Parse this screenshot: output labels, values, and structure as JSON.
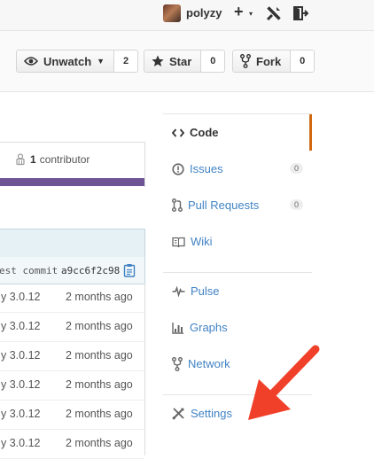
{
  "topbar": {
    "username": "polyzy",
    "plus": "+",
    "caret": "▾"
  },
  "repo_actions": {
    "watch": {
      "label": "Unwatch",
      "count": "2"
    },
    "star": {
      "label": "Star",
      "count": "0"
    },
    "fork": {
      "label": "Fork",
      "count": "0"
    }
  },
  "contributors": {
    "count": "1",
    "label": "contributor"
  },
  "file_table": {
    "commit_label": "est commit",
    "commit_sha": "a9cc6f2c98",
    "rows": [
      {
        "message": "y 3.0.12",
        "age": "2 months ago"
      },
      {
        "message": "y 3.0.12",
        "age": "2 months ago"
      },
      {
        "message": "y 3.0.12",
        "age": "2 months ago"
      },
      {
        "message": "y 3.0.12",
        "age": "2 months ago"
      },
      {
        "message": "y 3.0.12",
        "age": "2 months ago"
      },
      {
        "message": "y 3.0.12",
        "age": "2 months ago"
      }
    ]
  },
  "repo_nav": {
    "code": "Code",
    "issues": {
      "label": "Issues",
      "count": "0"
    },
    "pull_requests": {
      "label": "Pull Requests",
      "count": "0"
    },
    "wiki": "Wiki",
    "pulse": "Pulse",
    "graphs": "Graphs",
    "network": "Network",
    "settings": "Settings"
  },
  "colors": {
    "link": "#4183c4",
    "selected_accent": "#d26911",
    "contrib_bar": "#6e5494",
    "arrow": "#f0402a"
  },
  "icons": [
    "tools-icon",
    "sign-out-icon",
    "eye-icon",
    "star-icon",
    "fork-icon",
    "code-icon",
    "issue-icon",
    "pull-request-icon",
    "book-icon",
    "pulse-icon",
    "graph-icon",
    "network-icon",
    "settings-icon",
    "clipboard-icon",
    "organization-icon"
  ]
}
